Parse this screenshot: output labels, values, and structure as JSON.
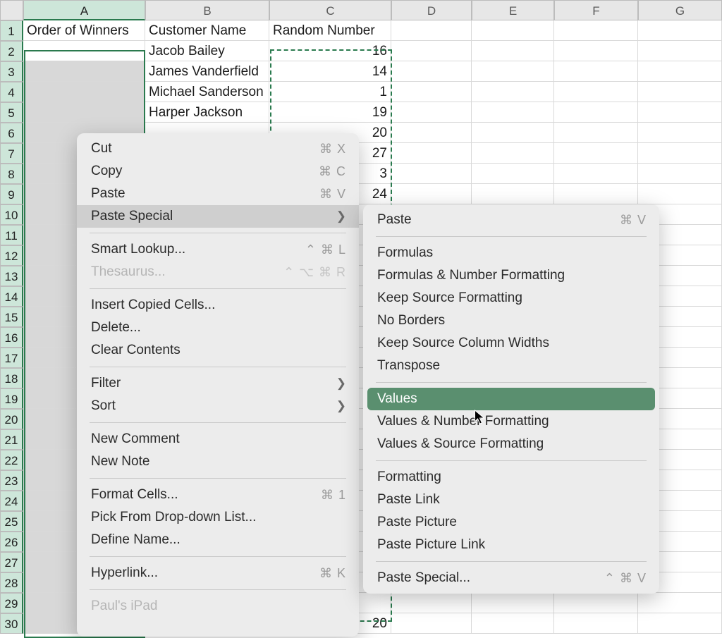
{
  "columns": [
    "A",
    "B",
    "C",
    "D",
    "E",
    "F",
    "G"
  ],
  "headers": {
    "A": "Order of Winners",
    "B": "Customer Name",
    "C": "Random Number"
  },
  "rows": [
    {
      "b": "Jacob Bailey",
      "c": "16"
    },
    {
      "b": "James Vanderfield",
      "c": "14"
    },
    {
      "b": "Michael Sanderson",
      "c": "1"
    },
    {
      "b": "Harper Jackson",
      "c": "19"
    },
    {
      "b": "",
      "c": "20"
    },
    {
      "b": "",
      "c": "27"
    },
    {
      "b": "",
      "c": "3"
    },
    {
      "b": "",
      "c": "24"
    },
    {
      "b": "",
      "c": ""
    },
    {
      "b": "",
      "c": ""
    },
    {
      "b": "",
      "c": ""
    },
    {
      "b": "",
      "c": ""
    },
    {
      "b": "",
      "c": ""
    },
    {
      "b": "",
      "c": ""
    },
    {
      "b": "",
      "c": ""
    },
    {
      "b": "",
      "c": ""
    },
    {
      "b": "",
      "c": ""
    },
    {
      "b": "",
      "c": ""
    },
    {
      "b": "",
      "c": ""
    },
    {
      "b": "",
      "c": ""
    },
    {
      "b": "",
      "c": ""
    },
    {
      "b": "",
      "c": ""
    },
    {
      "b": "",
      "c": ""
    },
    {
      "b": "",
      "c": ""
    },
    {
      "b": "",
      "c": ""
    },
    {
      "b": "",
      "c": ""
    },
    {
      "b": "",
      "c": ""
    },
    {
      "b": "",
      "c": ""
    },
    {
      "b": "",
      "c": "20"
    }
  ],
  "menu": {
    "cut": "Cut",
    "cut_sc": "⌘ X",
    "copy": "Copy",
    "copy_sc": "⌘ C",
    "paste": "Paste",
    "paste_sc": "⌘ V",
    "paste_special": "Paste Special",
    "smart_lookup": "Smart Lookup...",
    "smart_lookup_sc": "⌃ ⌘ L",
    "thesaurus": "Thesaurus...",
    "thesaurus_sc": "⌃ ⌥ ⌘ R",
    "insert_copied": "Insert Copied Cells...",
    "delete": "Delete...",
    "clear": "Clear Contents",
    "filter": "Filter",
    "sort": "Sort",
    "new_comment": "New Comment",
    "new_note": "New Note",
    "format_cells": "Format Cells...",
    "format_cells_sc": "⌘ 1",
    "pick_list": "Pick From Drop-down List...",
    "define_name": "Define Name...",
    "hyperlink": "Hyperlink...",
    "hyperlink_sc": "⌘ K",
    "pauls_ipad": "Paul's iPad"
  },
  "submenu": {
    "paste": "Paste",
    "paste_sc": "⌘ V",
    "formulas": "Formulas",
    "formulas_nf": "Formulas & Number Formatting",
    "keep_src": "Keep Source Formatting",
    "no_borders": "No Borders",
    "keep_widths": "Keep Source Column Widths",
    "transpose": "Transpose",
    "values": "Values",
    "values_nf": "Values & Number Formatting",
    "values_sf": "Values & Source Formatting",
    "formatting": "Formatting",
    "paste_link": "Paste Link",
    "paste_picture": "Paste Picture",
    "paste_picture_link": "Paste Picture Link",
    "paste_special": "Paste Special...",
    "paste_special_sc": "⌃ ⌘ V"
  }
}
